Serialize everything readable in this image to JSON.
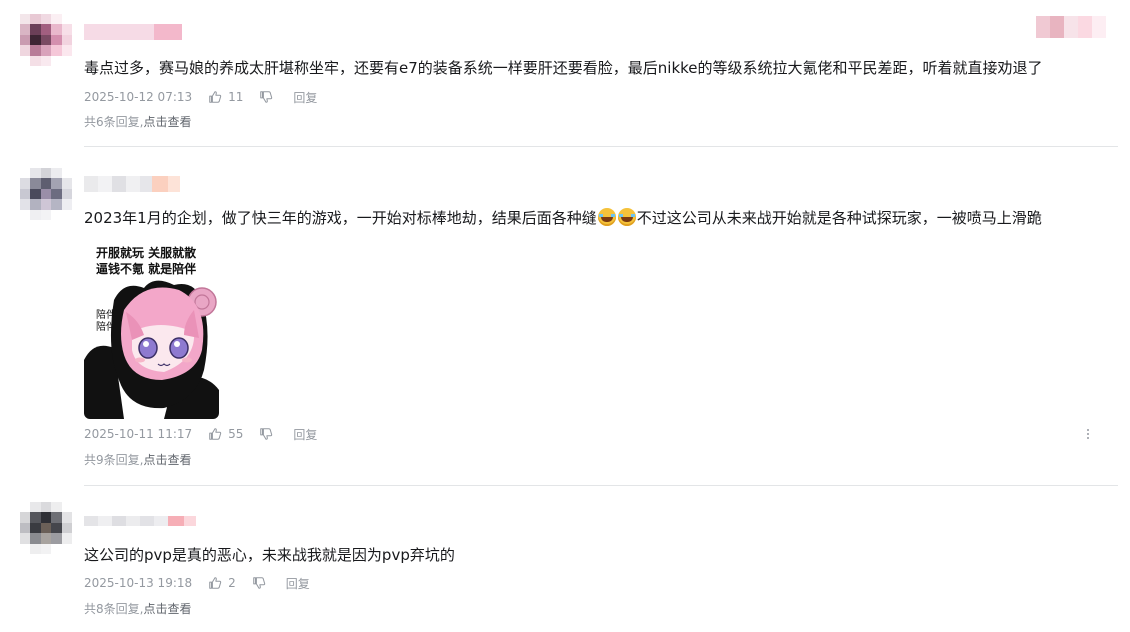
{
  "comments": [
    {
      "text": "毒点过多，赛马娘的养成太肝堪称坐牢，还要有e7的装备系统一样要肝还要看脸，最后nikke的等级系统拉大氪佬和平民差距，听着就直接劝退了",
      "time": "2025-10-12 07:13",
      "likes": "11",
      "reply_label": "回复",
      "replies": "共6条回复,",
      "replies_click": "点击查看"
    },
    {
      "text_a": "2023年1月的企划，做了快三年的游戏，一开始对标棒地劫，结果后面各种缝",
      "text_b": "不过这公司从未来战开始就是各种试探玩家，一被喷马上滑跪",
      "sticker": {
        "line1": "开服就玩 关服就散",
        "line2": "逼钱不氪 就是陪伴",
        "side1": "陪伴",
        "side2": "陪伴"
      },
      "time": "2025-10-11 11:17",
      "likes": "55",
      "reply_label": "回复",
      "replies": "共9条回复,",
      "replies_click": "点击查看"
    },
    {
      "text": "这公司的pvp是真的恶心，未来战我就是因为pvp弃坑的",
      "time": "2025-10-13 19:18",
      "likes": "2",
      "reply_label": "回复",
      "replies": "共8条回复,",
      "replies_click": "点击查看"
    }
  ],
  "icons": {
    "like": "thumbs-up-icon",
    "dislike": "thumbs-down-icon",
    "more": "more-vertical-icon",
    "emoji": "laugh-cry-emoji"
  },
  "colors": {
    "meta": "#9499a0",
    "text": "#18191c",
    "divider": "#e3e5e7"
  }
}
